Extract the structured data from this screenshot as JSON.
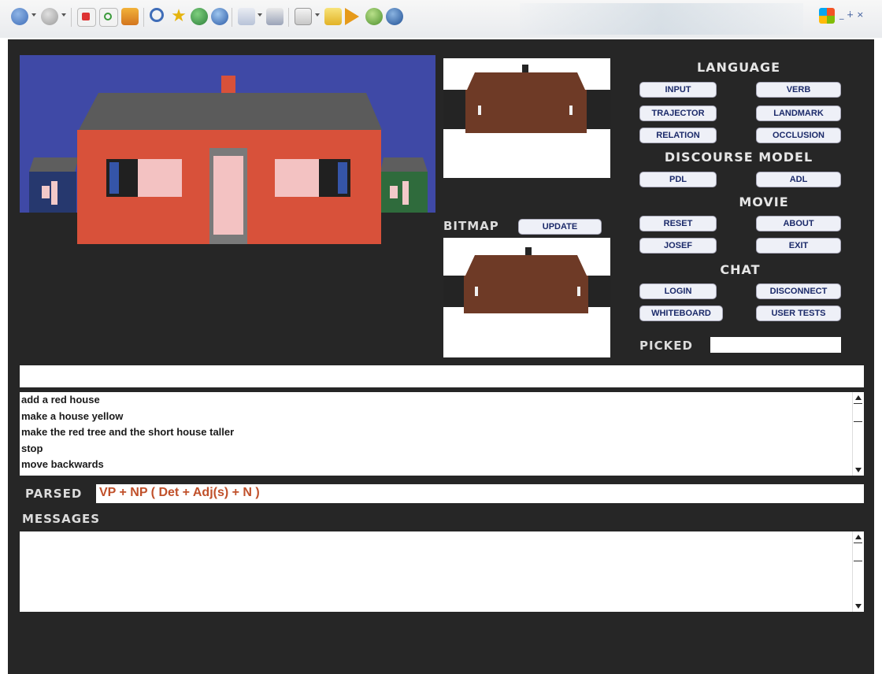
{
  "toolbar": {
    "icons": [
      "back-icon",
      "forward-icon",
      "stop-icon",
      "refresh-icon",
      "home-icon",
      "search-icon",
      "favorites-icon",
      "media-icon",
      "history-icon",
      "mail-icon",
      "print-icon",
      "edit-icon",
      "folder-icon",
      "arrow-icon",
      "messenger-icon",
      "research-icon"
    ],
    "window_controls": "_ ∔ ×"
  },
  "panels": {
    "bitmap_label": "BITMAP",
    "picked_label": "PICKED",
    "picked_value": ""
  },
  "language": {
    "heading": "LANGUAGE",
    "buttons": {
      "input": "INPUT",
      "verb": "VERB",
      "trajector": "TRAJECTOR",
      "landmark": "LANDMARK",
      "relation": "RELATION",
      "occlusion": "OCCLUSION"
    }
  },
  "discourse": {
    "heading": "DISCOURSE MODEL",
    "pdl": "PDL",
    "adl": "ADL"
  },
  "movie": {
    "heading": "MOVIE",
    "reset": "RESET",
    "about": "ABOUT",
    "josef": "JOSEF",
    "exit": "EXIT"
  },
  "chat": {
    "heading": "CHAT",
    "login": "LOGIN",
    "disconnect": "DISCONNECT",
    "whiteboard": "WHITEBOARD",
    "user_tests": "USER TESTS"
  },
  "update_button": "UPDATE",
  "input_field": {
    "value": ""
  },
  "commands": [
    "add a red house",
    "make a house yellow",
    "make the red tree and the short house taller",
    "stop",
    "move backwards"
  ],
  "parsed": {
    "label": "PARSED",
    "value": "VP + NP ( Det + Adj(s) + N )"
  },
  "messages": {
    "label": "MESSAGES",
    "value": ""
  },
  "colors": {
    "background": "#262626",
    "scene_sky": "#3f49a6",
    "house_wall": "#d8513a",
    "roof": "#5b5b5b",
    "parsed_text": "#c0502a",
    "bitmap_house": "#6e3a26"
  }
}
